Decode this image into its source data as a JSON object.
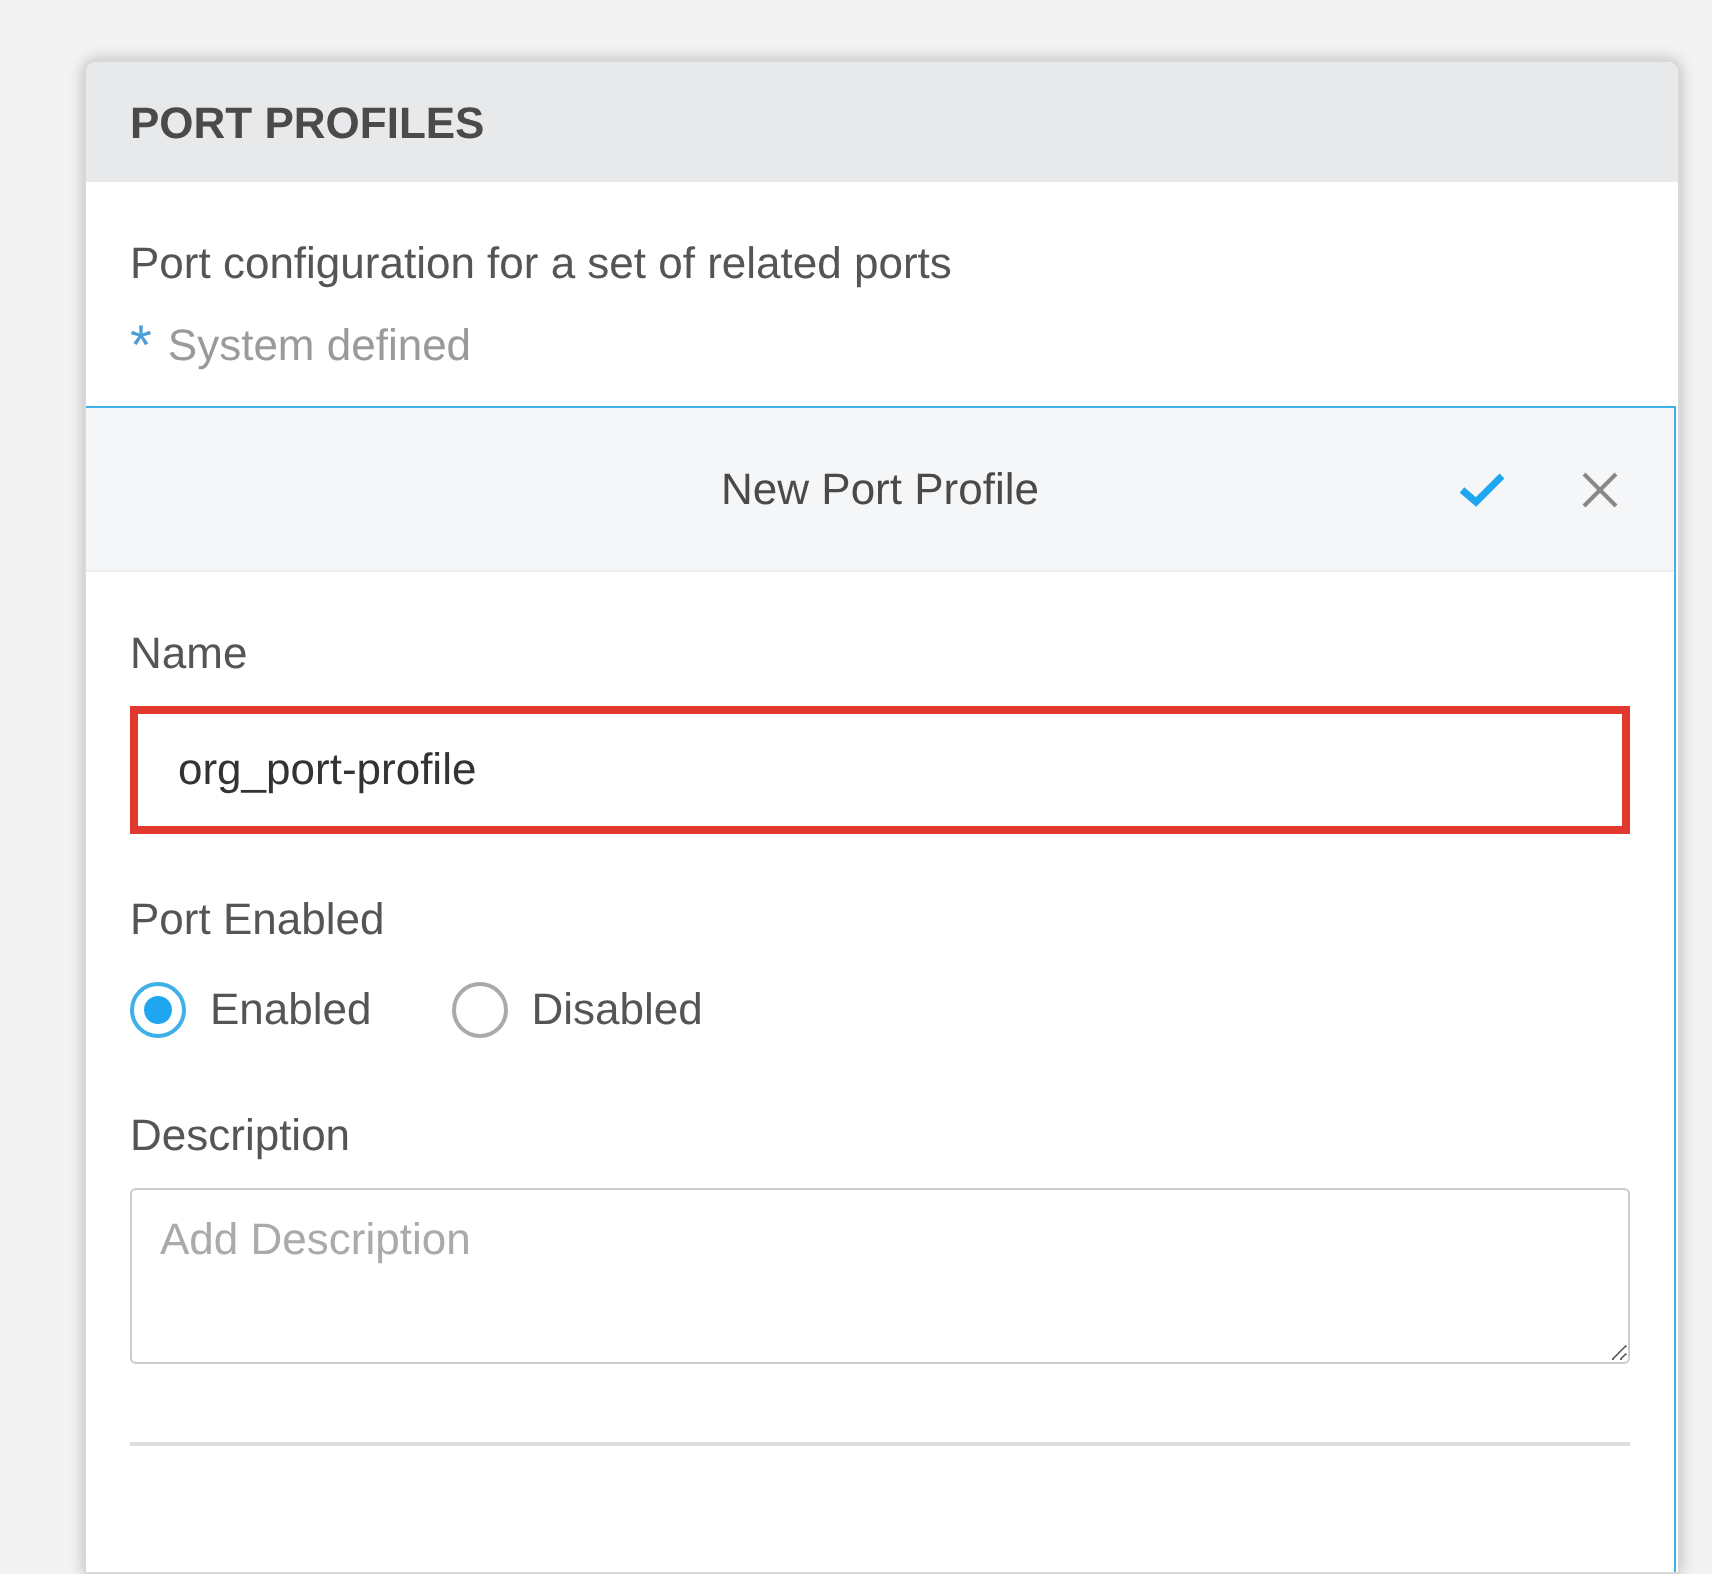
{
  "panel": {
    "title": "PORT PROFILES",
    "description": "Port configuration for a set of related ports",
    "legend": {
      "symbol": "*",
      "label": "System defined"
    }
  },
  "editor": {
    "title": "New Port Profile",
    "name_field": {
      "label": "Name",
      "value": "org_port-profile",
      "highlighted": true
    },
    "port_enabled": {
      "label": "Port Enabled",
      "options": [
        {
          "label": "Enabled",
          "selected": true
        },
        {
          "label": "Disabled",
          "selected": false
        }
      ]
    },
    "description_field": {
      "label": "Description",
      "placeholder": "Add Description"
    }
  }
}
